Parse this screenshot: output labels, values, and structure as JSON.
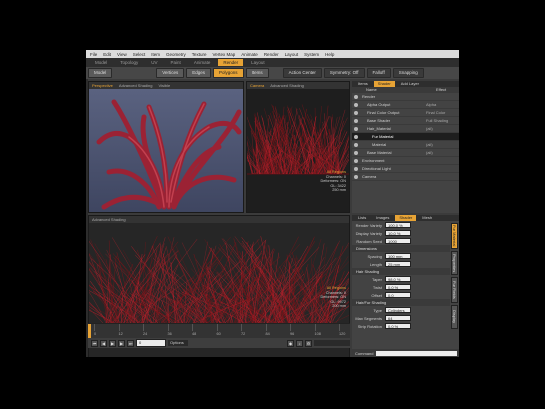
{
  "menu": [
    "File",
    "Edit",
    "View",
    "Select",
    "Item",
    "Geometry",
    "Texture",
    "Vertex Map",
    "Animate",
    "Render",
    "Layout",
    "System",
    "Help"
  ],
  "tabs": [
    "Model",
    "Topology",
    "UV",
    "Paint",
    "Animate",
    "Render",
    "Layout"
  ],
  "toolbar": {
    "model_btn": "Model",
    "vertices_btn": "Vertices",
    "edges_btn": "Edges",
    "polygons_btn": "Polygons",
    "items_btn": "Items",
    "action_center": "Action Center",
    "symmetry": "Symmetry: Off",
    "falloff": "Falloff",
    "snapping": "Snapping"
  },
  "viewport_top_left": {
    "header": [
      "Perspective",
      "Advanced Shading",
      "Visible"
    ],
    "active": "Perspective"
  },
  "viewport_top_right": {
    "header": [
      "Camera",
      "Advanced Shading"
    ],
    "active": "Camera"
  },
  "viewport_bottom": {
    "header": [
      "Advanced Shading"
    ],
    "active": ""
  },
  "info_top_right": [
    "Channels: 0",
    "Deformers: ON",
    "GL: 3422",
    "250 mm"
  ],
  "info_top_right_hl": "All Regions",
  "info_bottom": [
    "Channels: 0",
    "Deformers: ON",
    "GL: 9972",
    "200 mm"
  ],
  "info_bottom_hl": "All Regions",
  "shader_tree": {
    "tabs": [
      "Items",
      "Shader",
      "Add Layer"
    ],
    "active_tab": "Shader",
    "columns": [
      "Name",
      "Effect"
    ],
    "rows": [
      {
        "name": "Render",
        "effect": "",
        "indent": 0
      },
      {
        "name": "Alpha Output",
        "effect": "Alpha",
        "indent": 1
      },
      {
        "name": "Final Color Output",
        "effect": "Final Color",
        "indent": 1
      },
      {
        "name": "Base Shader",
        "effect": "Full Shading",
        "indent": 1
      },
      {
        "name": "Hair_Material",
        "effect": "(all)",
        "indent": 1
      },
      {
        "name": "Fur Material",
        "effect": "",
        "indent": 2,
        "selected": true
      },
      {
        "name": "Material",
        "effect": "(all)",
        "indent": 2
      },
      {
        "name": "Base Material",
        "effect": "(all)",
        "indent": 1
      },
      {
        "name": "Environment",
        "effect": "",
        "indent": 0
      },
      {
        "name": "Directional Light",
        "effect": "",
        "indent": 0
      },
      {
        "name": "Camera",
        "effect": "",
        "indent": 0
      }
    ]
  },
  "properties": {
    "tabs": [
      "Lists",
      "Images",
      "Shader",
      "Mesh"
    ],
    "active_tab": "Shader",
    "rows_top": [
      {
        "label": "Render Variety",
        "value": "100.0 %"
      },
      {
        "label": "Display Variety",
        "value": "10.0 %"
      },
      {
        "label": "Random Seed",
        "value": "1000"
      }
    ],
    "dimensions_label": "Dimensions",
    "rows_mid": [
      {
        "label": "Spacing",
        "value": "100 mm"
      },
      {
        "label": "Length",
        "value": "25 mm"
      }
    ],
    "shading_label": "Hair Shading",
    "rows_shading": [
      {
        "label": "Taper",
        "value": "98.0 %"
      },
      {
        "label": "Twist",
        "value": "0.0 %"
      },
      {
        "label": "Offset",
        "value": "0.0"
      }
    ],
    "strip_label": "Hair/Fur Shading",
    "rows_bottom": [
      {
        "label": "Type",
        "value": "Cylinders"
      },
      {
        "label": "Max Segments",
        "value": "64"
      },
      {
        "label": "Strip Rotation",
        "value": "0.0 %"
      }
    ],
    "side_tabs": [
      "Fur Material",
      "Properties",
      "Fur Fields",
      "Display"
    ]
  },
  "timeline": {
    "ticks": [
      "0",
      "12",
      "24",
      "36",
      "48",
      "60",
      "72",
      "84",
      "96",
      "108",
      "120"
    ],
    "frame": "0",
    "playhead": 0,
    "options": "Options"
  },
  "command_label": "Command",
  "colors": {
    "accent": "#e7a335",
    "fur": "#b0202a",
    "viewport_bg": "#2a2a2a"
  }
}
